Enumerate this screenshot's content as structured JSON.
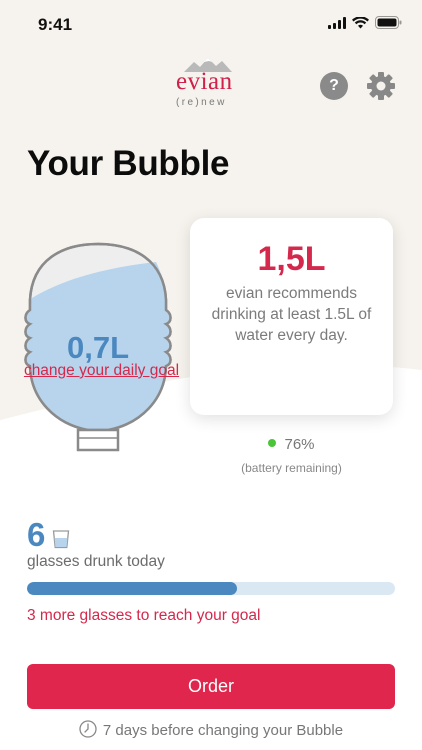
{
  "status_bar": {
    "time": "9:41"
  },
  "header": {
    "logo_word": "evian",
    "logo_tagline": "(re)new",
    "help_label": "?"
  },
  "page": {
    "title": "Your Bubble"
  },
  "bubble": {
    "current_value": "0,7L"
  },
  "goal_card": {
    "value": "1,5L",
    "description": "evian recommends drinking at least 1.5L of water every day.",
    "change_goal_link": "change your daily goal"
  },
  "battery": {
    "percent_text": "76%",
    "label": "(battery remaining)"
  },
  "glasses": {
    "count": "6",
    "label": "glasses drunk today",
    "progress_fraction": 0.57,
    "note": "3 more glasses to reach your goal"
  },
  "order_button": {
    "label": "Order"
  },
  "footer": {
    "text": "7 days before changing your Bubble"
  },
  "colors": {
    "brand_red": "#e0264c",
    "water_blue": "#4a88bf",
    "battery_green": "#4cc43a",
    "background": "#f6f2ed"
  },
  "icons": [
    "signal-icon",
    "wifi-icon",
    "battery-icon",
    "help-icon",
    "gear-icon",
    "glass-icon",
    "clock-icon"
  ]
}
